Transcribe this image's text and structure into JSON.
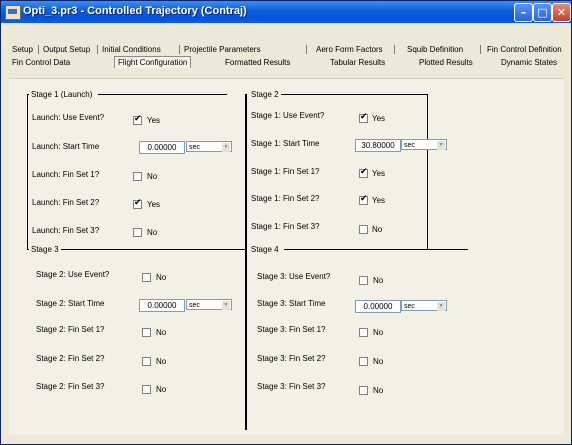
{
  "window": {
    "title": "Opti_3.pr3 - Controlled Trajectory (Contraj)"
  },
  "tabs_row1": [
    "Setup",
    "Output Setup",
    "Initial Conditions",
    "Projectile Parameters",
    "Aero Form Factors",
    "Squib Definition",
    "Fin Control Definition"
  ],
  "tabs_row2": [
    "Fin Control Data",
    "Flight Configuration",
    "Formatted Results",
    "Tabular Results",
    "Plotted Results",
    "Dynamic States"
  ],
  "active_tab": "Flight Configuration",
  "stage1": {
    "title": "Stage 1 (Launch)",
    "use_event_label": "Launch: Use Event?",
    "use_event_value": "Yes",
    "start_time_label": "Launch: Start Time",
    "start_time_value": "0.00000",
    "start_time_unit": "sec",
    "fin1_label": "Launch: Fin Set 1?",
    "fin1_value": "No",
    "fin2_label": "Launch: Fin Set 2?",
    "fin2_value": "Yes",
    "fin3_label": "Launch: Fin Set 3?",
    "fin3_value": "No"
  },
  "stage2": {
    "title": "Stage 2",
    "use_event_label": "Stage 1: Use Event?",
    "use_event_value": "Yes",
    "start_time_label": "Stage 1: Start Time",
    "start_time_value": "30.80000",
    "start_time_unit": "sec",
    "fin1_label": "Stage 1: Fin Set 1?",
    "fin1_value": "Yes",
    "fin2_label": "Stage 1: Fin Set 2?",
    "fin2_value": "Yes",
    "fin3_label": "Stage 1: Fin Set 3?",
    "fin3_value": "No"
  },
  "stage3": {
    "title": "Stage 3",
    "use_event_label": "Stage 2: Use Event?",
    "use_event_value": "No",
    "start_time_label": "Stage 2: Start Time",
    "start_time_value": "0.00000",
    "start_time_unit": "sec",
    "fin1_label": "Stage 2: Fin Set 1?",
    "fin1_value": "No",
    "fin2_label": "Stage 2: Fin Set 2?",
    "fin2_value": "No",
    "fin3_label": "Stage 2: Fin Set 3?",
    "fin3_value": "No"
  },
  "stage4": {
    "title": "Stage 4",
    "use_event_label": "Stage 3: Use Event?",
    "use_event_value": "No",
    "start_time_label": "Stage 3: Start Time",
    "start_time_value": "0.00000",
    "start_time_unit": "sec",
    "fin1_label": "Stage 3: Fin Set 1?",
    "fin1_value": "No",
    "fin2_label": "Stage 3: Fin Set 2?",
    "fin2_value": "No",
    "fin3_label": "Stage 3: Fin Set 3?",
    "fin3_value": "No"
  },
  "checks": {
    "s1_use": true,
    "s1_f1": false,
    "s1_f2": true,
    "s1_f3": false,
    "s2_use": true,
    "s2_f1": true,
    "s2_f2": true,
    "s2_f3": false,
    "s3_use": false,
    "s3_f1": false,
    "s3_f2": false,
    "s3_f3": false,
    "s4_use": false,
    "s4_f1": false,
    "s4_f2": false,
    "s4_f3": false
  },
  "colors": {
    "titlebar": "#0053e1",
    "background": "#ece9d8"
  },
  "icons": {
    "minimize": "minimize-icon",
    "maximize": "maximize-icon",
    "close": "close-icon"
  }
}
